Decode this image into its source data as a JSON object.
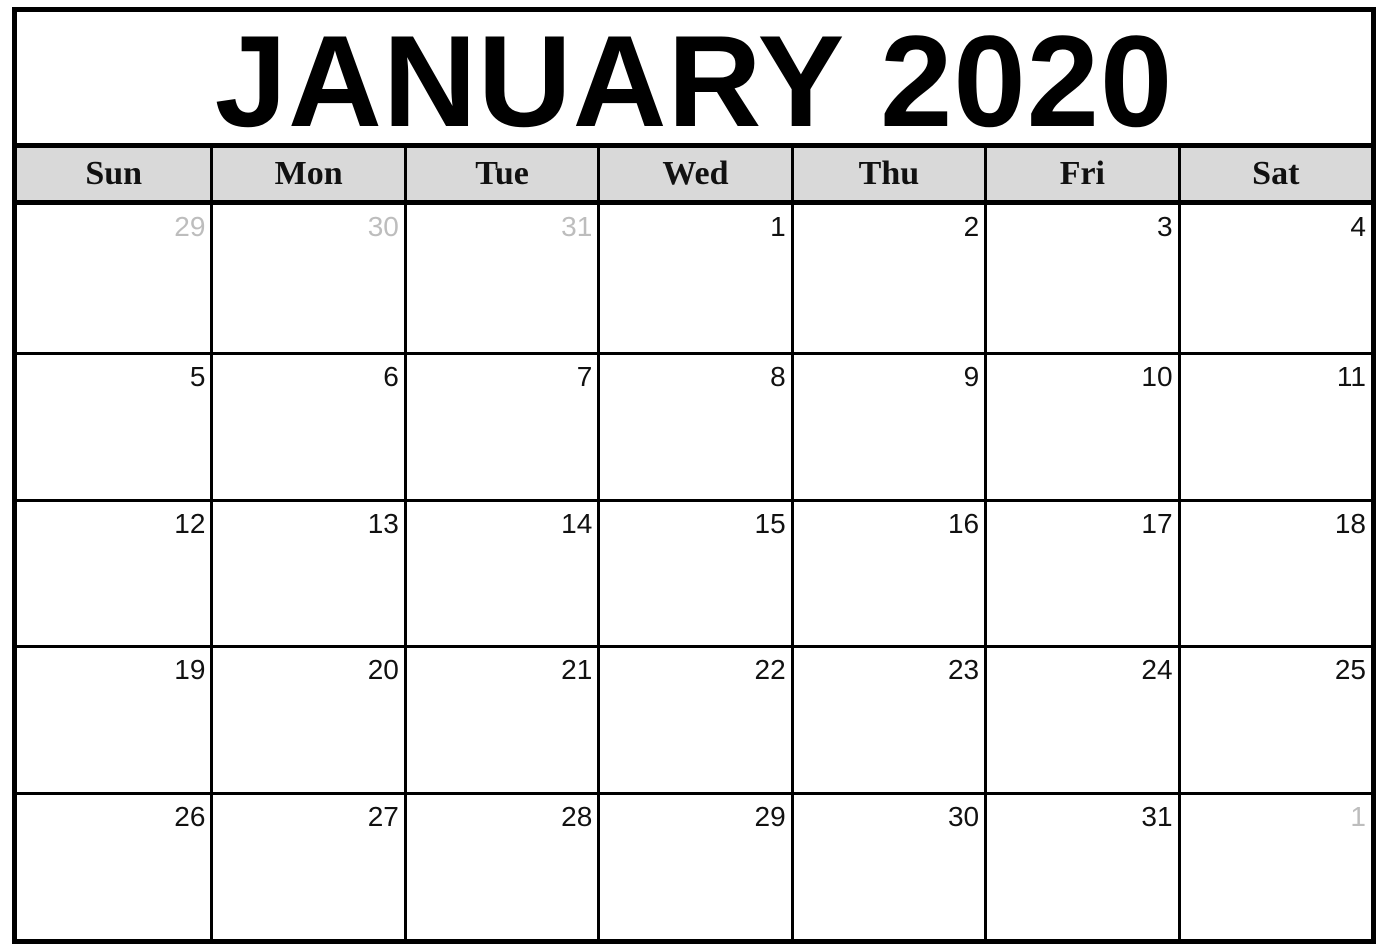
{
  "title": "JANUARY 2020",
  "weekdays": [
    "Sun",
    "Mon",
    "Tue",
    "Wed",
    "Thu",
    "Fri",
    "Sat"
  ],
  "days": [
    {
      "n": "29",
      "other": true
    },
    {
      "n": "30",
      "other": true
    },
    {
      "n": "31",
      "other": true
    },
    {
      "n": "1"
    },
    {
      "n": "2"
    },
    {
      "n": "3"
    },
    {
      "n": "4"
    },
    {
      "n": "5"
    },
    {
      "n": "6"
    },
    {
      "n": "7"
    },
    {
      "n": "8"
    },
    {
      "n": "9"
    },
    {
      "n": "10"
    },
    {
      "n": "11"
    },
    {
      "n": "12"
    },
    {
      "n": "13"
    },
    {
      "n": "14"
    },
    {
      "n": "15"
    },
    {
      "n": "16"
    },
    {
      "n": "17"
    },
    {
      "n": "18"
    },
    {
      "n": "19"
    },
    {
      "n": "20"
    },
    {
      "n": "21"
    },
    {
      "n": "22"
    },
    {
      "n": "23"
    },
    {
      "n": "24"
    },
    {
      "n": "25"
    },
    {
      "n": "26"
    },
    {
      "n": "27"
    },
    {
      "n": "28"
    },
    {
      "n": "29"
    },
    {
      "n": "30"
    },
    {
      "n": "31"
    },
    {
      "n": "1",
      "other": true
    }
  ],
  "colors": {
    "header_bg": "#d9d9d9",
    "other_month": "#bdbdbd"
  }
}
